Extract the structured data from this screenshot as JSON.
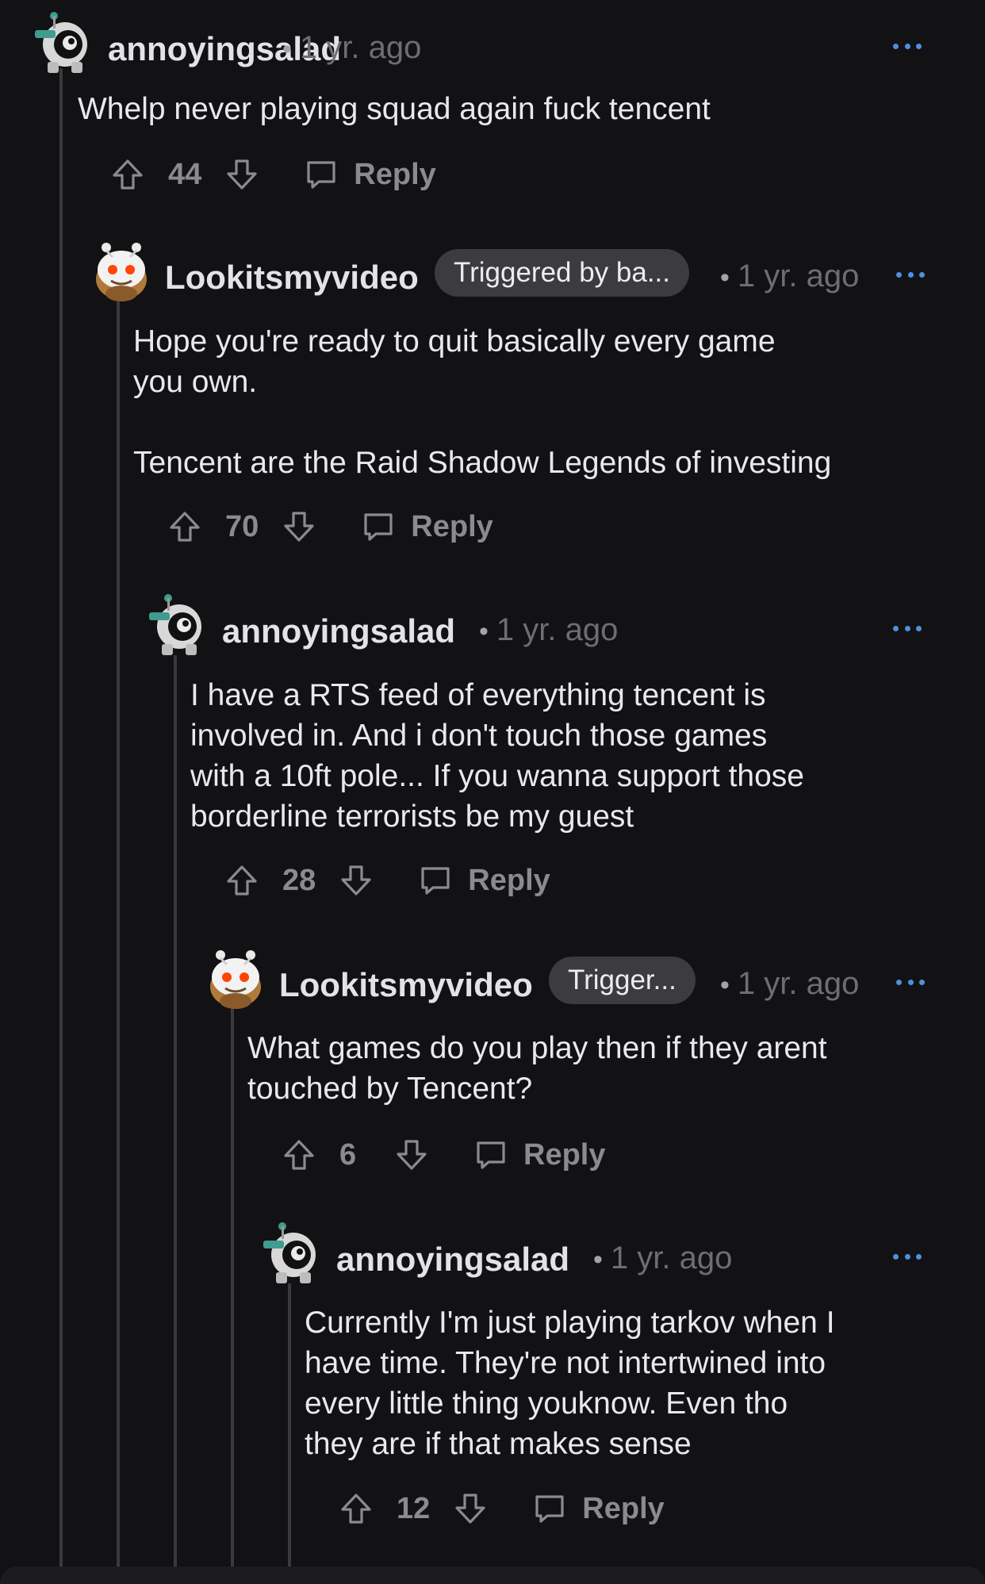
{
  "comments": [
    {
      "username": "annoyingsalad",
      "avatar": "robot-avatar-icon",
      "flair": "",
      "time": "1 yr. ago",
      "body": "Whelp never playing squad again fuck tencent",
      "votes": "44",
      "reply_label": "Reply"
    },
    {
      "username": "Lookitsmyvideo",
      "avatar": "snoo-bee-avatar-icon",
      "flair": "Triggered by ba...",
      "time": "1 yr. ago",
      "body": "Hope you're ready to quit basically every game\nyou own.\n\nTencent are the Raid Shadow Legends of investing",
      "votes": "70",
      "reply_label": "Reply"
    },
    {
      "username": "annoyingsalad",
      "avatar": "robot-avatar-icon",
      "flair": "",
      "time": "1 yr. ago",
      "body": "I have a RTS feed of everything tencent is\ninvolved in. And i don't touch those games\nwith a 10ft pole... If you wanna support those\nborderline terrorists be my guest",
      "votes": "28",
      "reply_label": "Reply"
    },
    {
      "username": "Lookitsmyvideo",
      "avatar": "snoo-bee-avatar-icon",
      "flair": "Trigger...",
      "time": "1 yr. ago",
      "body": "What games do you play then if they arent\ntouched by Tencent?",
      "votes": "6",
      "reply_label": "Reply"
    },
    {
      "username": "annoyingsalad",
      "avatar": "robot-avatar-icon",
      "flair": "",
      "time": "1 yr. ago",
      "body": "Currently I'm just playing tarkov when I\nhave time. They're not intertwined into\nevery little thing youknow. Even tho\nthey are if that makes sense",
      "votes": "12",
      "reply_label": "Reply"
    }
  ],
  "colors": {
    "background": "#121214",
    "accent_more": "#4f8fe0",
    "thread_line": "#3a3a3e",
    "flair_bg": "#3c3c40",
    "muted_text": "#8a8a90"
  }
}
